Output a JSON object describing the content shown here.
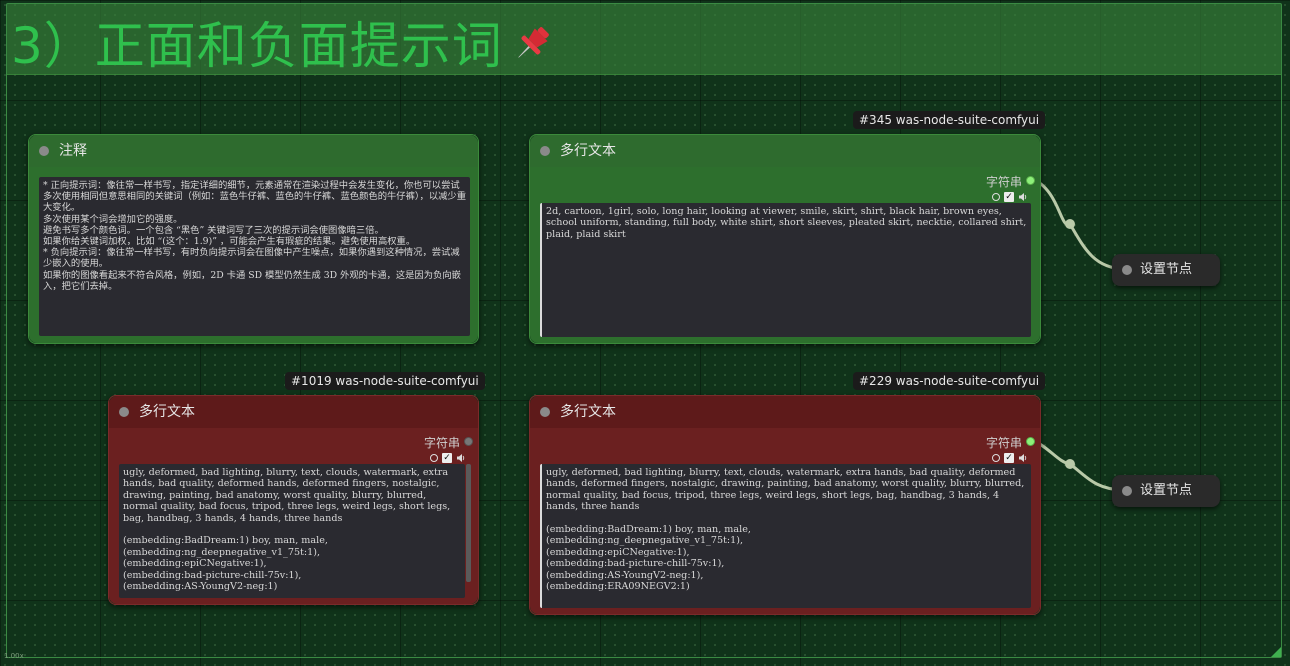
{
  "group": {
    "title": "3）正面和负面提示词",
    "icon": "pushpin-icon"
  },
  "nodes": {
    "note": {
      "title": "注释",
      "text": "* 正向提示词：像往常一样书写，指定详细的细节，元素通常在渲染过程中会发生变化，你也可以尝试多次使用相同但意思相同的关键词（例如：蓝色牛仔裤、蓝色的牛仔裤、蓝色颜色的牛仔裤），以减少重大变化。\n多次使用某个词会增加它的强度。\n避免书写多个颜色词。一个包含 “黑色” 关键词写了三次的提示词会使图像暗三倍。\n如果你给关键词加权，比如 “(这个：1.9)” ，可能会产生有瑕疵的结果。避免使用高权重。\n* 负向提示词：像往常一样书写，有时负向提示词会在图像中产生噪点，如果你遇到这种情况，尝试减少嵌入的使用。\n如果你的图像看起来不符合风格，例如，2D 卡通 SD 模型仍然生成 3D 外观的卡通，这是因为负向嵌入，把它们去掉。"
    },
    "positive": {
      "badge": "#345 was-node-suite-comfyui",
      "title": "多行文本",
      "output_label": "字符串",
      "text": "2d, cartoon, 1girl, solo, long hair, looking at viewer, smile, skirt, shirt, black hair, brown eyes, school uniform, standing, full body, white shirt, short sleeves, pleated skirt, necktie, collared shirt, plaid, plaid skirt"
    },
    "negative_left": {
      "badge": "#1019 was-node-suite-comfyui",
      "title": "多行文本",
      "output_label": "字符串",
      "text": "ugly, deformed, bad lighting, blurry, text, clouds, watermark, extra hands, bad quality, deformed hands, deformed fingers, nostalgic, drawing, painting, bad anatomy, worst quality, blurry, blurred, normal quality, bad focus, tripod, three legs, weird legs, short legs, bag, handbag, 3 hands, 4 hands, three hands\n\n(embedding:BadDream:1) boy, man, male,\n(embedding:ng_deepnegative_v1_75t:1),\n(embedding:epiCNegative:1),\n(embedding:bad-picture-chill-75v:1),\n(embedding:AS-YoungV2-neg:1)"
    },
    "negative_right": {
      "badge": "#229 was-node-suite-comfyui",
      "title": "多行文本",
      "output_label": "字符串",
      "text": "ugly, deformed, bad lighting, blurry, text, clouds, watermark, extra hands, bad quality, deformed hands, deformed fingers, nostalgic, drawing, painting, bad anatomy, worst quality, blurry, blurred, normal quality, bad focus, tripod, three legs, weird legs, short legs, bag, handbag, 3 hands, 4 hands, three hands\n\n(embedding:BadDream:1) boy, man, male,\n(embedding:ng_deepnegative_v1_75t:1),\n(embedding:epiCNegative:1),\n(embedding:bad-picture-chill-75v:1),\n(embedding:AS-YoungV2-neg:1),\n(embedding:ERA09NEGV2:1)"
    },
    "set_node_top": {
      "title": "设置节点"
    },
    "set_node_bottom": {
      "title": "设置节点"
    }
  },
  "zoom_text": "1.00x",
  "colors": {
    "canvas": "#10331a",
    "group_title": "#2fc04d",
    "green_node": "#2d6f2d",
    "red_node": "#6b2020",
    "link": "#b9c9a8",
    "slot_active": "#8df07a"
  }
}
